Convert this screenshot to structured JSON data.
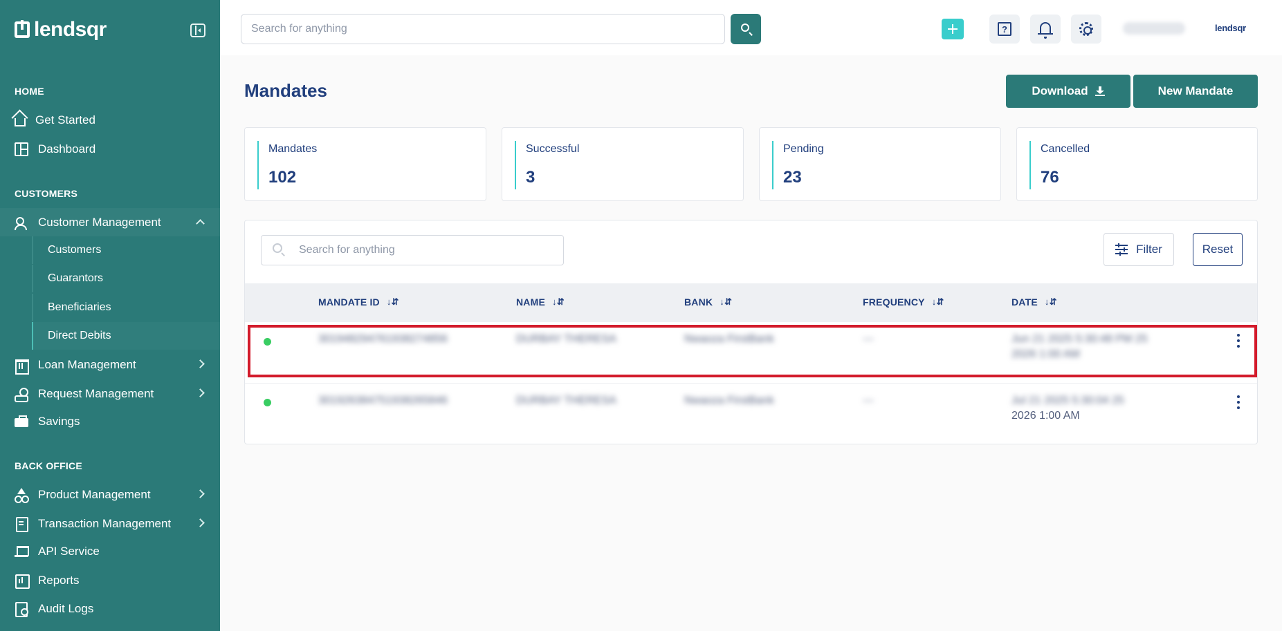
{
  "sidebar": {
    "brand": "lendsqr",
    "sections": {
      "home": "HOME",
      "customers": "CUSTOMERS",
      "back_office": "BACK OFFICE"
    },
    "items": {
      "get_started": "Get Started",
      "dashboard": "Dashboard",
      "customer_management": "Customer Management",
      "customers": "Customers",
      "guarantors": "Guarantors",
      "beneficiaries": "Beneficiaries",
      "direct_debits": "Direct Debits",
      "loan_management": "Loan Management",
      "request_management": "Request Management",
      "savings": "Savings",
      "product_management": "Product Management",
      "transaction_management": "Transaction Management",
      "api_service": "API Service",
      "reports": "Reports",
      "audit_logs": "Audit Logs"
    }
  },
  "topbar": {
    "search_placeholder": "Search for anything",
    "help_glyph": "?",
    "org_brand": "lendsqr"
  },
  "page": {
    "title": "Mandates",
    "download_label": "Download",
    "new_mandate_label": "New Mandate"
  },
  "stats": [
    {
      "label": "Mandates",
      "value": "102"
    },
    {
      "label": "Successful",
      "value": "3"
    },
    {
      "label": "Pending",
      "value": "23"
    },
    {
      "label": "Cancelled",
      "value": "76"
    }
  ],
  "table": {
    "search_placeholder": "Search for anything",
    "filter_label": "Filter",
    "reset_label": "Reset",
    "sort_glyph": "↓⇵",
    "columns": [
      "MANDATE ID",
      "NAME",
      "BANK",
      "FREQUENCY",
      "DATE"
    ],
    "rows": [
      {
        "mandate_id": "301948294761938274856",
        "name": "DURBAY THERESA",
        "bank": "Nwaoza FirstBank",
        "frequency": "---",
        "date_line1": "Jun 21 2025 5:30:48 PM 25",
        "date_line2": "2026 1:00 AM",
        "status_color": "#39cd62"
      },
      {
        "mandate_id": "301926384751938265846",
        "name": "DURBAY THERESA",
        "bank": "Nwaoza FirstBank",
        "frequency": "---",
        "date_line1": "Jul 21 2025 5:30:04 25",
        "date_line2": "2026 1:00 AM",
        "status_color": "#39cd62"
      }
    ]
  },
  "colors": {
    "sidebar_bg": "#2b7a78",
    "primary": "#2b7a78",
    "accent": "#39cdcc",
    "text": "#213f7d",
    "highlight": "#d31b2b"
  }
}
